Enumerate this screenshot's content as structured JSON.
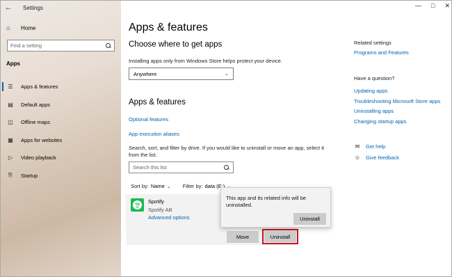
{
  "window": {
    "title": "Settings"
  },
  "sidebar": {
    "home_label": "Home",
    "search_placeholder": "Find a setting",
    "section_label": "Apps",
    "items": [
      {
        "label": "Apps & features",
        "icon": "apps-list-icon"
      },
      {
        "label": "Default apps",
        "icon": "default-apps-icon"
      },
      {
        "label": "Offline maps",
        "icon": "map-icon"
      },
      {
        "label": "Apps for websites",
        "icon": "web-link-icon"
      },
      {
        "label": "Video playback",
        "icon": "video-icon"
      },
      {
        "label": "Startup",
        "icon": "startup-icon"
      }
    ]
  },
  "main": {
    "page_title": "Apps & features",
    "choose_heading": "Choose where to get apps",
    "choose_desc": "Installing apps only from Windows Store helps protect your device.",
    "source_value": "Anywhere",
    "apps_heading": "Apps & features",
    "optional_features_link": "Optional features",
    "execution_aliases_link": "App execution aliases",
    "filter_desc": "Search, sort, and filter by drive. If you would like to uninstall or move an app, select it from the list.",
    "list_search_placeholder": "Search this list",
    "sort_label": "Sort by:",
    "sort_value": "Name",
    "filter_label": "Filter by:",
    "filter_value": "data (E:)",
    "app": {
      "name": "Spotify",
      "publisher": "Spotify AB",
      "advanced_link": "Advanced options",
      "move_label": "Move",
      "uninstall_label": "Uninstall"
    },
    "popup": {
      "message": "This app and its related info will be uninstalled.",
      "button_label": "Uninstall"
    }
  },
  "right": {
    "related_heading": "Related settings",
    "related_link": "Programs and Features",
    "question_heading": "Have a question?",
    "question_links": [
      "Updating apps",
      "Troubleshooting Microsoft Store apps",
      "Uninstalling apps",
      "Changing startup apps"
    ],
    "get_help": "Get help",
    "give_feedback": "Give feedback"
  },
  "colors": {
    "accent": "#0063b1",
    "highlight_border": "#c8161d",
    "spotify_green": "#1db954"
  }
}
